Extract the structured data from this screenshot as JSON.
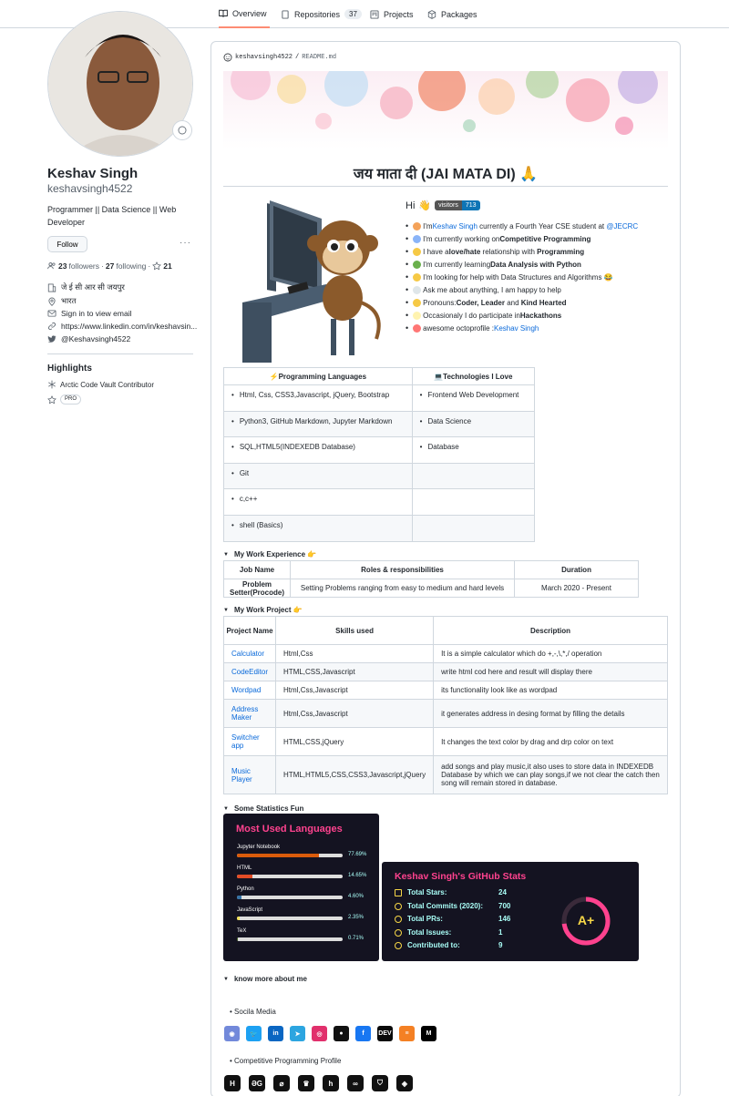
{
  "nav": {
    "tabs": [
      {
        "label": "Overview"
      },
      {
        "label": "Repositories",
        "count": "37"
      },
      {
        "label": "Projects"
      },
      {
        "label": "Packages"
      }
    ]
  },
  "profile": {
    "name": "Keshav Singh",
    "login": "keshavsingh4522",
    "bio": "Programmer || Data Science || Web Developer",
    "follow_label": "Follow",
    "followers": "23",
    "followers_label": "followers",
    "following": "27",
    "following_label": "following",
    "stars": "21",
    "org": "जे ई सी आर सी जयपुर",
    "location": "भारत",
    "email": "Sign in to view email",
    "website": "https://www.linkedin.com/in/keshavsin...",
    "twitter": "@Keshavsingh4522",
    "highlights_title": "Highlights",
    "highlight_1": "Arctic Code Vault Contributor",
    "highlight_2": "PRO"
  },
  "readme": {
    "path_user": "keshavsingh4522",
    "path_sep": "/",
    "path_file": "README.md",
    "heading": "जय माता दी (JAI MATA DI) 🙏",
    "hi": "Hi",
    "visitors_label": "visitors",
    "visitors_count": "713",
    "intro": [
      {
        "pre": "I'm ",
        "link": "Keshav Singh",
        "post": " currently a Fourth Year CSE student at ",
        "link2": "@JECRC",
        "color": "#f4a259"
      },
      {
        "pre": "I'm currently working on ",
        "bold": "Competitive Programming",
        "color": "#8ab4f8"
      },
      {
        "pre": "I have a ",
        "bold": "love/hate",
        "post": " relationship with ",
        "bold2": "Programming",
        "color": "#f6c945"
      },
      {
        "pre": "I'm currently learning ",
        "bold": "Data Analysis with Python",
        "color": "#6ab04c"
      },
      {
        "pre": "I'm looking for help with Data Structures and Algorithms 😂",
        "color": "#f6c945"
      },
      {
        "pre": "Ask me about anything, I am happy to help",
        "color": "#dfe6e9"
      },
      {
        "pre": "Pronouns: ",
        "bold": "Coder, Leader",
        "post": " and ",
        "bold2": "Kind Hearted",
        "color": "#f6c945"
      },
      {
        "pre": "Occasionaly I do participate in ",
        "bold": "Hackathons",
        "color": "#fff3b0"
      },
      {
        "pre": "awesome octoprofile : ",
        "link": "Keshav Singh",
        "color": "#ff7675"
      }
    ],
    "langs_header": [
      "⚡Programming Languages",
      "💻Technologies I Love"
    ],
    "langs_rows": [
      [
        "Html, Css, CSS3,Javascript, jQuery, Bootstrap",
        "Frontend Web Development"
      ],
      [
        "Python3, GitHub Markdown, Jupyter Markdown",
        "Data Science"
      ],
      [
        "SQL,HTML5(INDEXEDB Database)",
        "Database"
      ],
      [
        "Git",
        ""
      ],
      [
        "c,c++",
        ""
      ],
      [
        "shell (Basics)",
        ""
      ]
    ],
    "work_exp_title": "My Work Experience 👉",
    "work_exp_header": [
      "Job Name",
      "Roles & responsibilities",
      "Duration"
    ],
    "work_exp_rows": [
      [
        "Problem Setter(Procode)",
        "Setting Problems ranging from easy to medium and hard levels",
        "March 2020 - Present"
      ]
    ],
    "project_title": "My Work Project 👉",
    "project_header": [
      "Project Name",
      "Skills used",
      "Description"
    ],
    "project_rows": [
      [
        "Calculator",
        "Html,Css",
        "It is a simple calculator which do +,-,\\,*,/ operation"
      ],
      [
        "CodeEditor",
        "HTML,CSS,Javascript",
        "write html cod here and result will display there"
      ],
      [
        "Wordpad",
        "Html,Css,Javascript",
        "its functionality look like as wordpad"
      ],
      [
        "Address Maker",
        "Html,Css,Javascript",
        "it generates address in desing format by filling the details"
      ],
      [
        "Switcher app",
        "HTML,CSS,jQuery",
        "It changes the text color by drag and drp color on text"
      ],
      [
        "Music Player",
        "HTML,HTML5,CSS,CSS3,Javascript,jQuery",
        "add songs and play music,it also uses to store data in INDEXEDB Database by which we can play songs,if we not clear the catch then song will remain stored in database."
      ]
    ],
    "stats_title": "Some Statistics Fun",
    "most_used": {
      "title": "Most Used Languages",
      "langs": [
        {
          "name": "Jupyter Notebook",
          "pct": "77.69%",
          "value": 77.69,
          "color": "#DA5B0B"
        },
        {
          "name": "HTML",
          "pct": "14.65%",
          "value": 14.65,
          "color": "#e34c26"
        },
        {
          "name": "Python",
          "pct": "4.60%",
          "value": 4.6,
          "color": "#3572A5"
        },
        {
          "name": "JavaScript",
          "pct": "2.35%",
          "value": 2.35,
          "color": "#f1e05a"
        },
        {
          "name": "TeX",
          "pct": "0.71%",
          "value": 0.71,
          "color": "#3D6117"
        }
      ]
    },
    "gh_stats": {
      "title": "Keshav Singh's GitHub Stats",
      "rows": [
        {
          "label": "Total Stars:",
          "value": "24"
        },
        {
          "label": "Total Commits (2020):",
          "value": "700"
        },
        {
          "label": "Total PRs:",
          "value": "146"
        },
        {
          "label": "Total Issues:",
          "value": "1"
        },
        {
          "label": "Contributed to:",
          "value": "9"
        }
      ],
      "rank": "A+"
    },
    "know_more_title": "know more about me",
    "social_label": "Socila Media",
    "social_icons": [
      {
        "name": "discord-icon",
        "color": "#7289da",
        "glyph": "◉"
      },
      {
        "name": "twitter-icon",
        "color": "#1da1f2",
        "glyph": "🐦"
      },
      {
        "name": "linkedin-icon",
        "color": "#0a66c2",
        "glyph": "in"
      },
      {
        "name": "telegram-icon",
        "color": "#2ca5e0",
        "glyph": "➤"
      },
      {
        "name": "instagram-icon",
        "color": "#e1306c",
        "glyph": "◎"
      },
      {
        "name": "reddit-icon",
        "color": "#111111",
        "glyph": "●"
      },
      {
        "name": "facebook-icon",
        "color": "#1877f2",
        "glyph": "f"
      },
      {
        "name": "dev-icon",
        "color": "#0a0a0a",
        "glyph": "DEV"
      },
      {
        "name": "stackoverflow-icon",
        "color": "#f48024",
        "glyph": "≡"
      },
      {
        "name": "medium-icon",
        "color": "#000000",
        "glyph": "M"
      }
    ],
    "cp_label": "Competitive Programming Profile",
    "cp_icons": [
      {
        "name": "hackerrank-icon",
        "glyph": "H"
      },
      {
        "name": "geeksforgeeks-icon",
        "glyph": "ƏG"
      },
      {
        "name": "leetcode-icon",
        "glyph": "⌀"
      },
      {
        "name": "codechef-icon",
        "glyph": "♛"
      },
      {
        "name": "hackerearth-icon",
        "glyph": "h"
      },
      {
        "name": "codeforces-icon",
        "glyph": "∞"
      },
      {
        "name": "topcoder-icon",
        "glyph": "⛉"
      },
      {
        "name": "interviewbit-icon",
        "glyph": "◈"
      }
    ]
  }
}
